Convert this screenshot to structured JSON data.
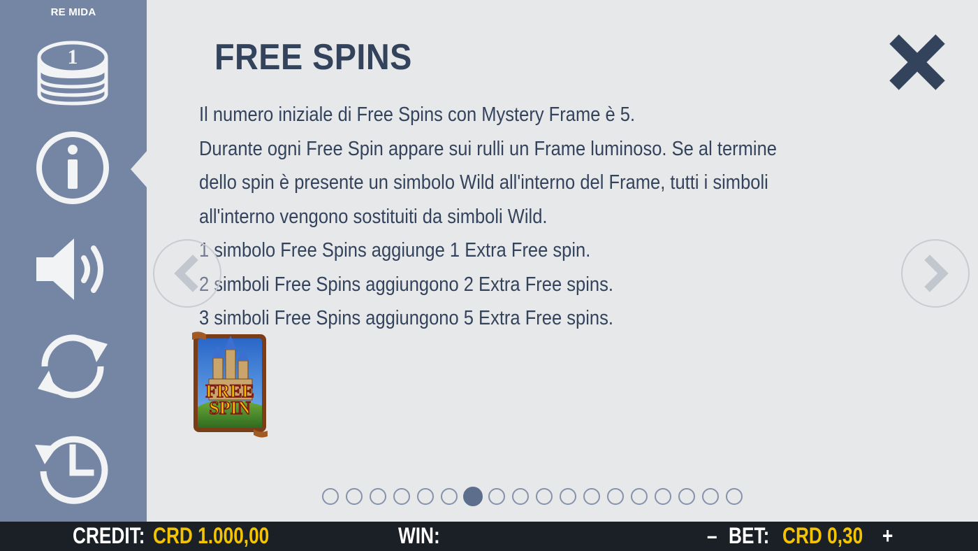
{
  "app": {
    "game_title": "RE MIDA"
  },
  "sidebar": {
    "items": [
      {
        "name": "coins",
        "icon": "coin-stack-icon"
      },
      {
        "name": "info",
        "icon": "info-icon",
        "active": true
      },
      {
        "name": "sound",
        "icon": "speaker-icon"
      },
      {
        "name": "autoplay",
        "icon": "refresh-icon"
      },
      {
        "name": "history",
        "icon": "history-clock-icon"
      }
    ],
    "coin_label": "1"
  },
  "page": {
    "title": "FREE SPINS",
    "lines": [
      "Il numero iniziale di Free Spins con Mystery Frame è 5.",
      "Durante ogni Free Spin appare sui rulli un Frame luminoso. Se al termine",
      "dello spin è presente un simbolo Wild all'interno del Frame, tutti i simboli",
      "all'interno vengono sostituiti da simboli Wild.",
      "1 simbolo Free Spins aggiunge 1 Extra Free spin.",
      "2 simboli Free Spins aggiungono 2 Extra Free spins.",
      "3 simboli Free Spins aggiungono 5 Extra Free spins."
    ],
    "symbol": {
      "line1": "FREE",
      "line2": "SPIN",
      "icon": "free-spin-castle-symbol"
    }
  },
  "pagination": {
    "total": 18,
    "current": 7
  },
  "bottom_bar": {
    "credit_label": "CREDIT:",
    "credit_value": "CRD 1.000,00",
    "win_label": "WIN:",
    "minus": "–",
    "bet_label": "BET:",
    "bet_value": "CRD 0,30",
    "plus": "+"
  },
  "colors": {
    "sidebar": "#7586a5",
    "panel": "#e7e8ea",
    "text": "#34435c",
    "accent": "#f5c400",
    "bottom_bar": "#1b2027"
  }
}
